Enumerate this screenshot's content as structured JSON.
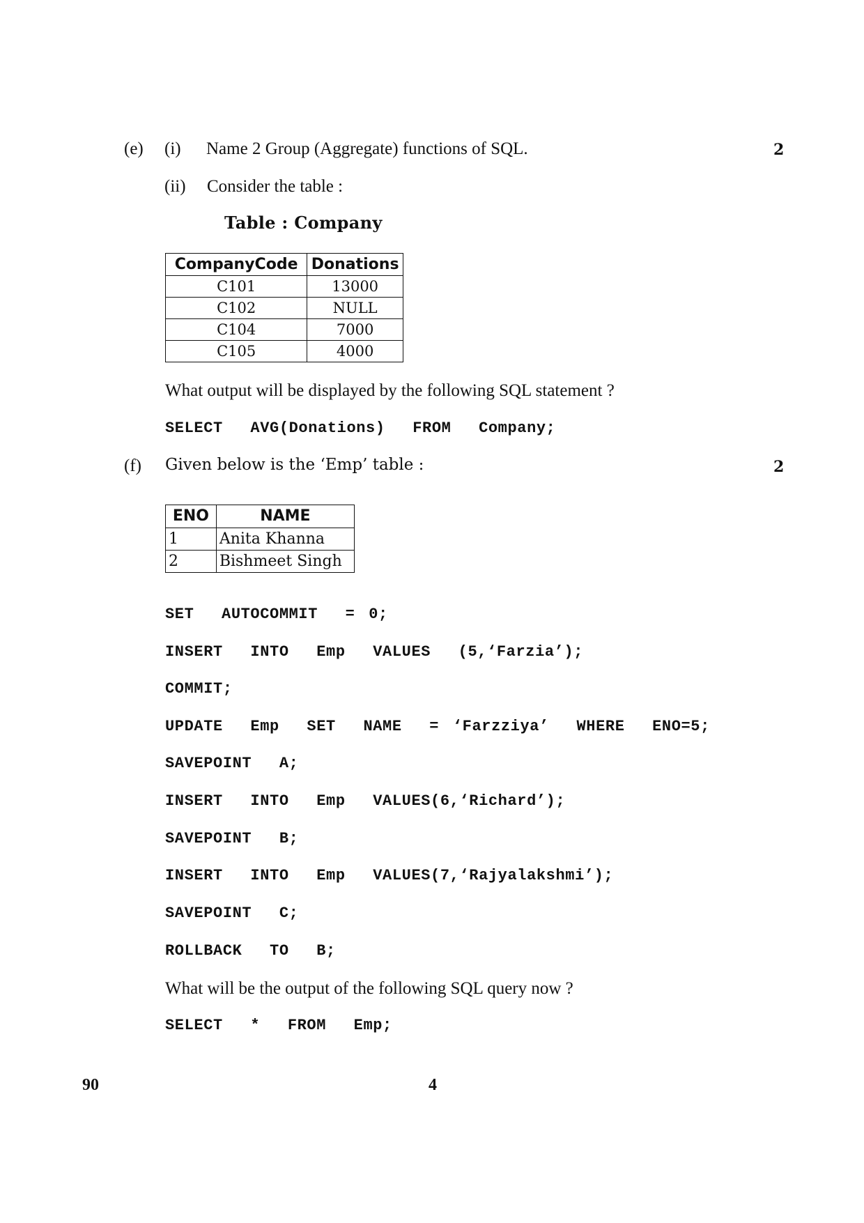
{
  "question_e": {
    "label": "(e)",
    "part_i": {
      "label": "(i)",
      "text": "Name 2 Group (Aggregate) functions of SQL.",
      "marks": "2"
    },
    "part_ii": {
      "label": "(ii)",
      "text": "Consider the table :",
      "table_title": "Table : Company",
      "table": {
        "headers": [
          "CompanyCode",
          "Donations"
        ],
        "rows": [
          [
            "C101",
            "13000"
          ],
          [
            "C102",
            "NULL"
          ],
          [
            "C104",
            "7000"
          ],
          [
            "C105",
            "4000"
          ]
        ]
      },
      "prompt": "What output will be displayed by the following SQL statement ?",
      "sql": "SELECT  AVG(Donations)  FROM  Company;"
    }
  },
  "question_f": {
    "label": "(f)",
    "text": "Given below is the ‘Emp’ table :",
    "marks": "2",
    "table": {
      "headers": [
        "ENO",
        "NAME"
      ],
      "rows": [
        [
          "1",
          "Anita Khanna"
        ],
        [
          "2",
          "Bishmeet Singh"
        ]
      ]
    },
    "code_lines": [
      "SET  AUTOCOMMIT  = 0;",
      "INSERT  INTO  Emp  VALUES  (5,‘Farzia’);",
      "COMMIT;",
      "UPDATE  Emp  SET  NAME  = ‘Farzziya’  WHERE  ENO=5;",
      "SAVEPOINT  A;",
      "INSERT  INTO  Emp  VALUES(6,‘Richard’);",
      "SAVEPOINT  B;",
      "INSERT  INTO  Emp  VALUES(7,‘Rajyalakshmi’);",
      "SAVEPOINT  C;",
      "ROLLBACK  TO  B;"
    ],
    "prompt": "What will be the output of the following SQL query now ?",
    "sql": "SELECT  *  FROM  Emp;"
  },
  "footer": {
    "code": "90",
    "page_number": "4"
  }
}
